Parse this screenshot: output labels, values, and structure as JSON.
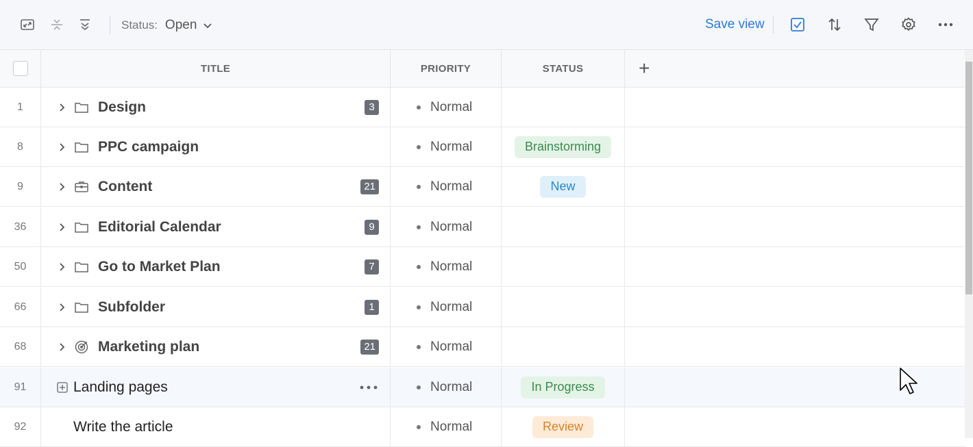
{
  "toolbar": {
    "icons": [
      "expand-icon",
      "collapse-icon",
      "expand-all-icon",
      "checkbox-icon",
      "sort-icon",
      "filter-icon",
      "gear-icon",
      "more-icon"
    ],
    "status_label": "Status:",
    "status_value": "Open",
    "save_view": "Save view",
    "accent": "#2b7bd9"
  },
  "columns": {
    "title": "TITLE",
    "priority": "PRIORITY",
    "status": "STATUS"
  },
  "rows": [
    {
      "id": "1",
      "title": "Design",
      "icon": "folder-icon",
      "count": "3",
      "priority": "Normal",
      "status": ""
    },
    {
      "id": "8",
      "title": "PPC campaign",
      "icon": "folder-icon",
      "count": "",
      "priority": "Normal",
      "status": "Brainstorming"
    },
    {
      "id": "9",
      "title": "Content",
      "icon": "briefcase-icon",
      "count": "21",
      "priority": "Normal",
      "status": "New"
    },
    {
      "id": "36",
      "title": "Editorial Calendar",
      "icon": "folder-icon",
      "count": "9",
      "priority": "Normal",
      "status": ""
    },
    {
      "id": "50",
      "title": "Go to Market Plan",
      "icon": "folder-icon",
      "count": "7",
      "priority": "Normal",
      "status": ""
    },
    {
      "id": "66",
      "title": "Subfolder",
      "icon": "folder-icon",
      "count": "1",
      "priority": "Normal",
      "status": ""
    },
    {
      "id": "68",
      "title": "Marketing plan",
      "icon": "target-icon",
      "count": "21",
      "priority": "Normal",
      "status": ""
    },
    {
      "id": "91",
      "title": "Landing pages",
      "icon": "",
      "count": "",
      "priority": "Normal",
      "status": "In Progress"
    },
    {
      "id": "92",
      "title": "Write the article",
      "icon": "",
      "count": "",
      "priority": "Normal",
      "status": "Review"
    }
  ],
  "status_colors": {
    "Brainstorming": {
      "bg": "#e3f4e6",
      "fg": "#3b8a4f"
    },
    "New": {
      "bg": "#e0f0fb",
      "fg": "#2f86c8"
    },
    "In Progress": {
      "bg": "#e3f4e6",
      "fg": "#3b8a4f"
    },
    "Review": {
      "bg": "#fdebd8",
      "fg": "#d9822b"
    }
  }
}
